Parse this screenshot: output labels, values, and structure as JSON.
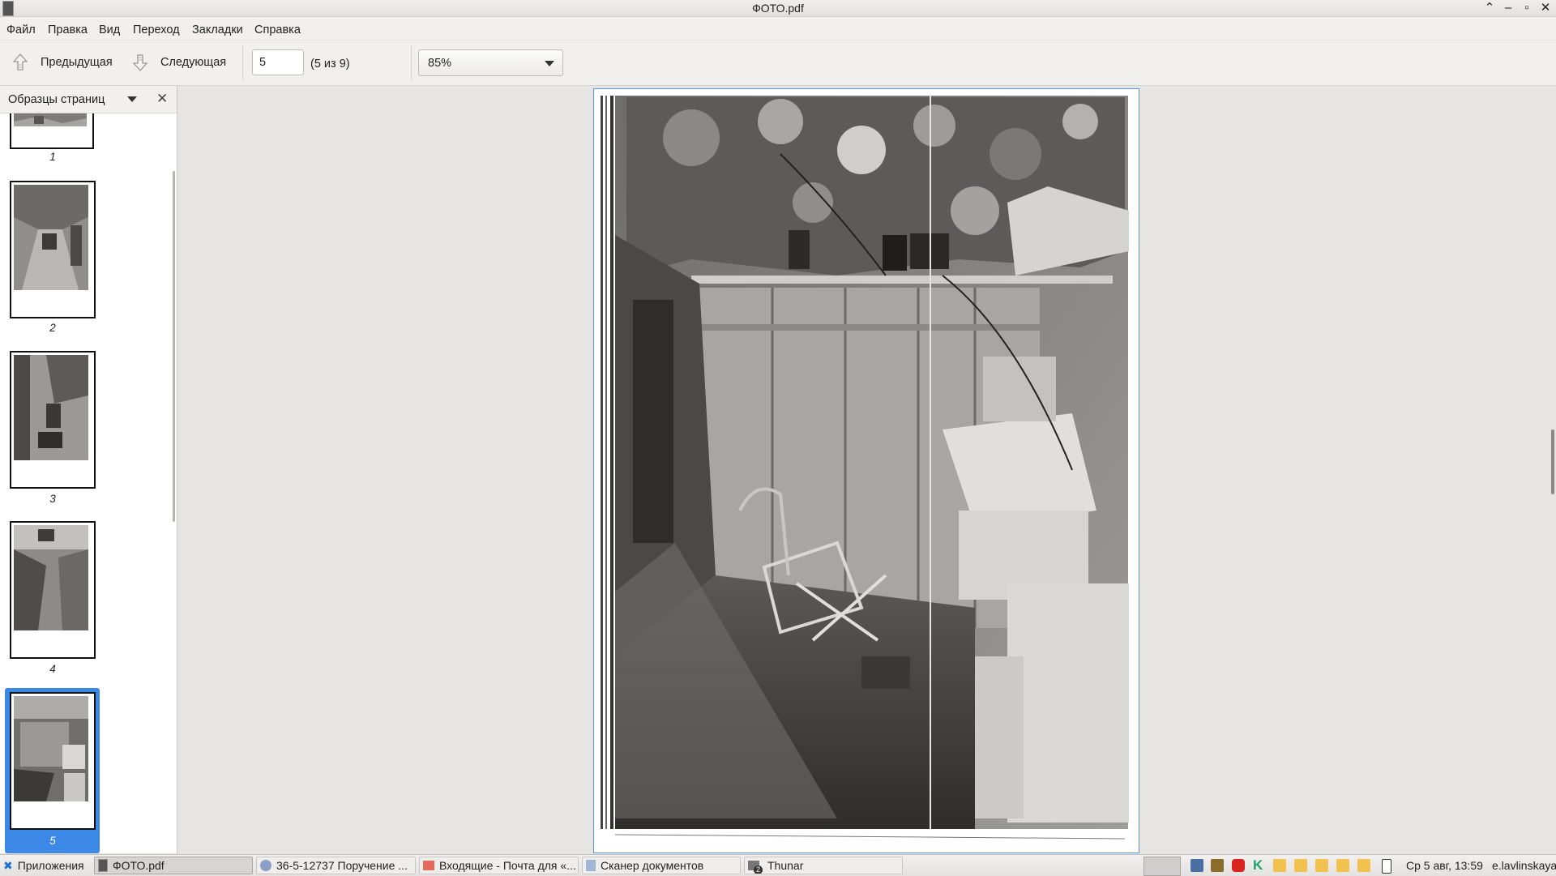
{
  "window": {
    "title": "ФОТО.pdf"
  },
  "menu": [
    "Файл",
    "Правка",
    "Вид",
    "Переход",
    "Закладки",
    "Справка"
  ],
  "toolbar": {
    "prev_label": "Предыдущая",
    "next_label": "Следующая",
    "page_value": "5",
    "page_count": "(5 из 9)",
    "zoom": "85%"
  },
  "sidebar": {
    "title": "Образцы страниц",
    "thumbnails": [
      "1",
      "2",
      "3",
      "4",
      "5"
    ],
    "selected": "5"
  },
  "taskbar": {
    "apps_label": "Приложения",
    "tasks": [
      {
        "label": "ФОТО.pdf",
        "icon": "document-icon"
      },
      {
        "label": "36-5-12737 Поручение ...",
        "icon": "browser-icon"
      },
      {
        "label": "Входящие - Почта для «...",
        "icon": "mail-icon"
      },
      {
        "label": "Сканер документов",
        "icon": "scanner-icon"
      },
      {
        "label": "Thunar",
        "icon": "folder-icon",
        "badge": "2"
      }
    ],
    "clock": "Ср 5 авг, 13:59",
    "user": "e.lavlinskaya"
  },
  "colors": {
    "accent": "#3b88e6",
    "page_border": "#5a95e0"
  }
}
